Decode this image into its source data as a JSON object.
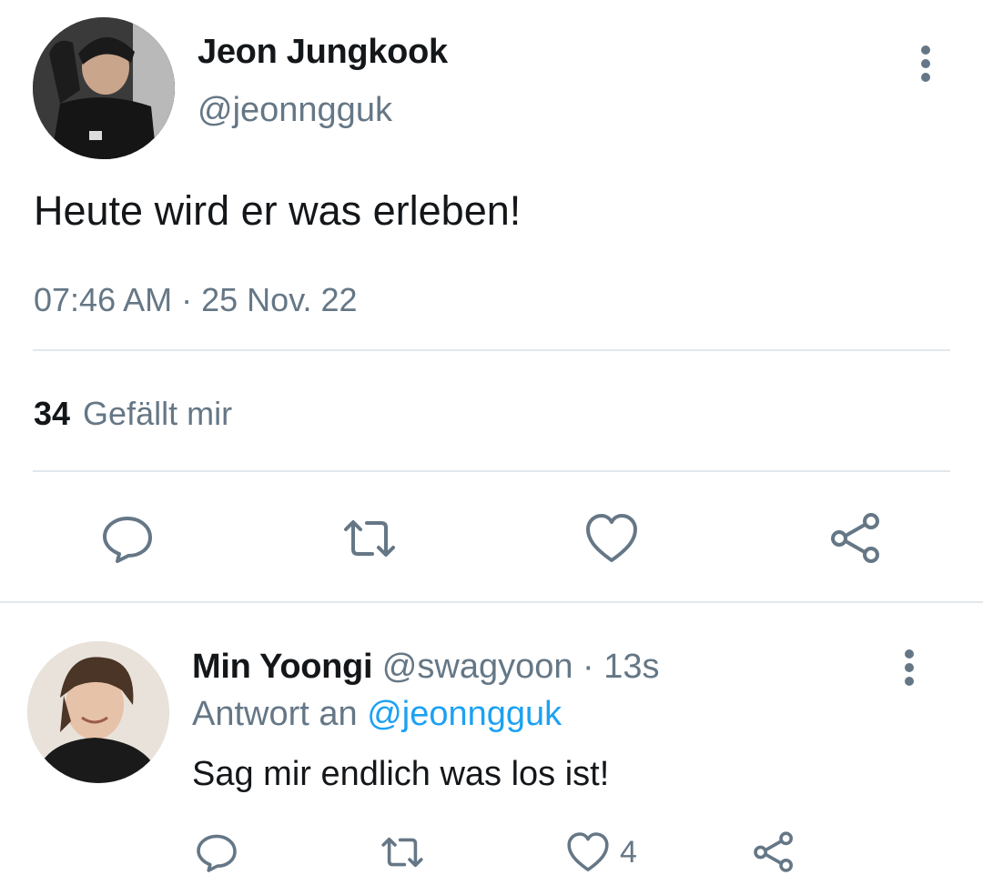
{
  "main_tweet": {
    "author_name": "Jeon Jungkook",
    "author_handle": "@jeonngguk",
    "text": "Heute wird er was erleben!",
    "time": "07:46 AM",
    "separator": "·",
    "date": "25 Nov. 22",
    "like_count": "34",
    "like_label": "Gefällt mir",
    "actions": [
      "reply-icon",
      "retweet-icon",
      "heart-icon",
      "share-icon"
    ]
  },
  "reply": {
    "author_name": "Min Yoongi",
    "author_handle": "@swagyoon",
    "separator": "·",
    "time": "13s",
    "reply_to_prefix": "Antwort an",
    "reply_to_mention": "@jeonngguk",
    "text": "Sag mir endlich was los ist!",
    "like_count": "4",
    "actions": [
      "reply-icon",
      "retweet-icon",
      "heart-icon",
      "share-icon"
    ]
  },
  "colors": {
    "text_primary": "#14171a",
    "text_secondary": "#657786",
    "accent": "#1da1f2",
    "divider": "#e1e8ed"
  }
}
